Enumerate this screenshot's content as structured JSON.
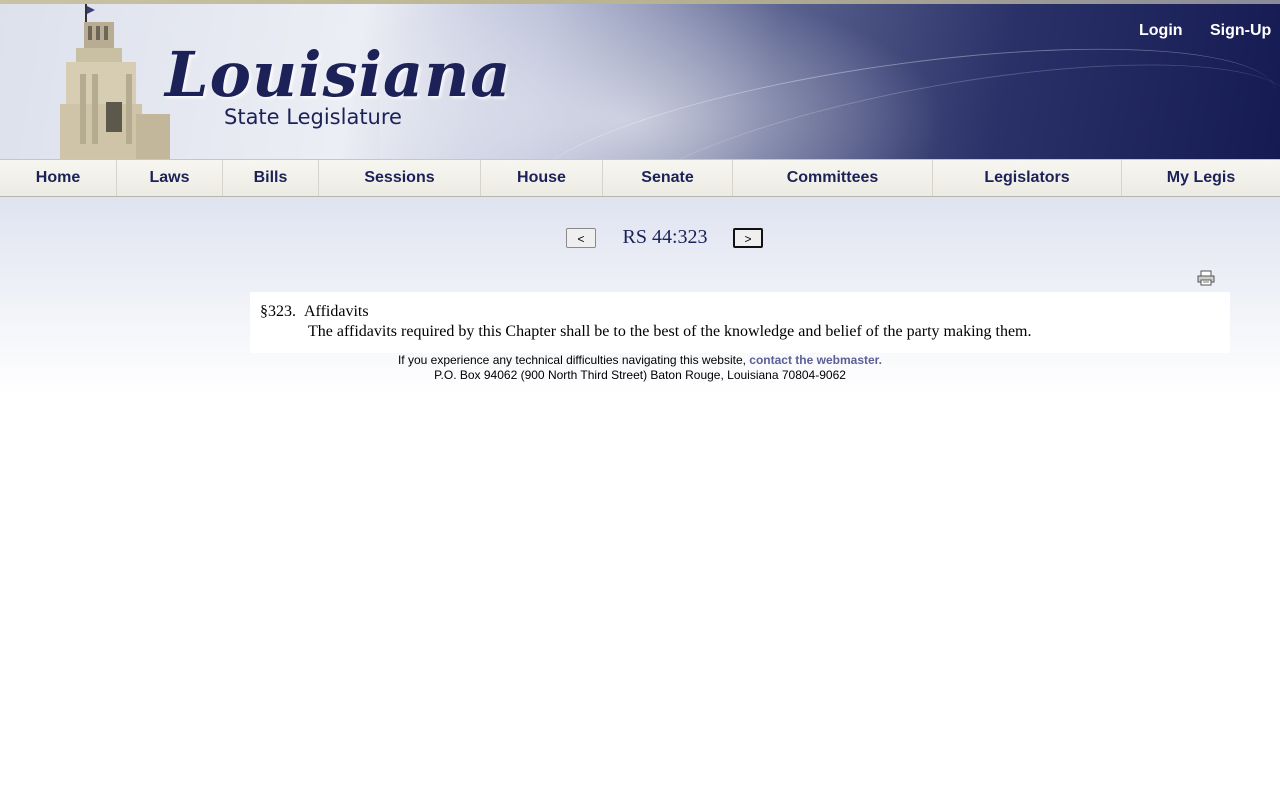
{
  "header": {
    "logo_title": "Louisiana",
    "logo_subtitle": "State Legislature",
    "login_label": "Login",
    "signup_label": "Sign-Up"
  },
  "nav": {
    "items": [
      "Home",
      "Laws",
      "Bills",
      "Sessions",
      "House",
      "Senate",
      "Committees",
      "Legislators",
      "My Legis"
    ]
  },
  "pager": {
    "prev_label": "<",
    "title": "RS 44:323",
    "next_label": ">"
  },
  "statute": {
    "section_number": "§323.",
    "section_title": "Affidavits",
    "body": "The affidavits required by this Chapter shall be to the best of the knowledge and belief of the party making them."
  },
  "footer": {
    "help_text": "If you experience any technical difficulties navigating this website,",
    "webmaster_link": "contact the webmaster.",
    "address": "P.O. Box 94062 (900 North Third Street) Baton Rouge, Louisiana 70804-9062"
  },
  "icons": {
    "print": "printer-icon",
    "building": "capitol-building-image"
  },
  "colors": {
    "brand_navy": "#1c2258",
    "link": "#5a5f95"
  }
}
